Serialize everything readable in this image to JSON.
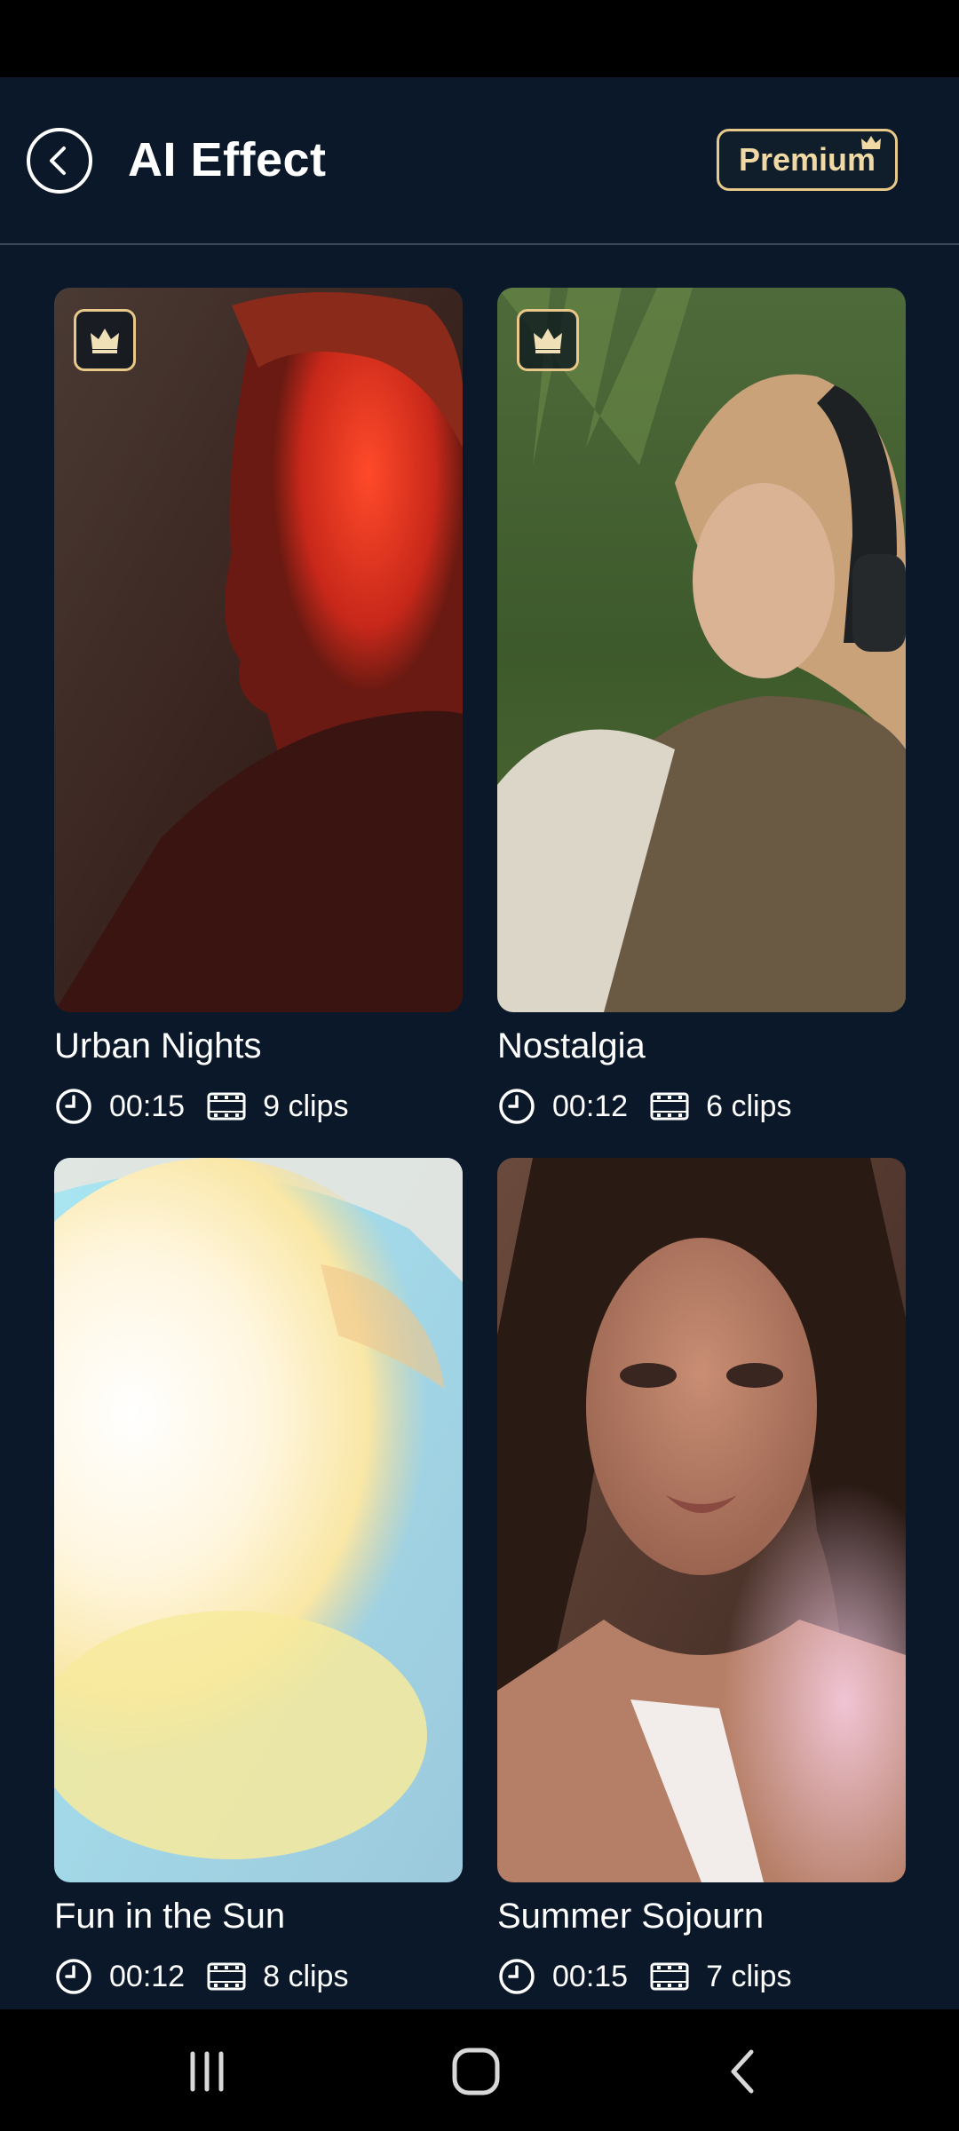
{
  "header": {
    "title": "AI Effect",
    "premium_label": "Premium",
    "back_icon": "back-arrow-icon"
  },
  "colors": {
    "background": "#0a1829",
    "accent_gold": "#e8c98a",
    "text": "#ffffff"
  },
  "cards": [
    {
      "title": "Urban Nights",
      "duration": "00:15",
      "clips": "9 clips",
      "premium": true
    },
    {
      "title": "Nostalgia",
      "duration": "00:12",
      "clips": "6 clips",
      "premium": true
    },
    {
      "title": "Fun in the Sun",
      "duration": "00:12",
      "clips": "8 clips",
      "premium": false
    },
    {
      "title": "Summer Sojourn",
      "duration": "00:15",
      "clips": "7 clips",
      "premium": false
    }
  ],
  "nav": {
    "recents_icon": "recents-icon",
    "home_icon": "home-icon",
    "back_icon": "nav-back-icon"
  }
}
